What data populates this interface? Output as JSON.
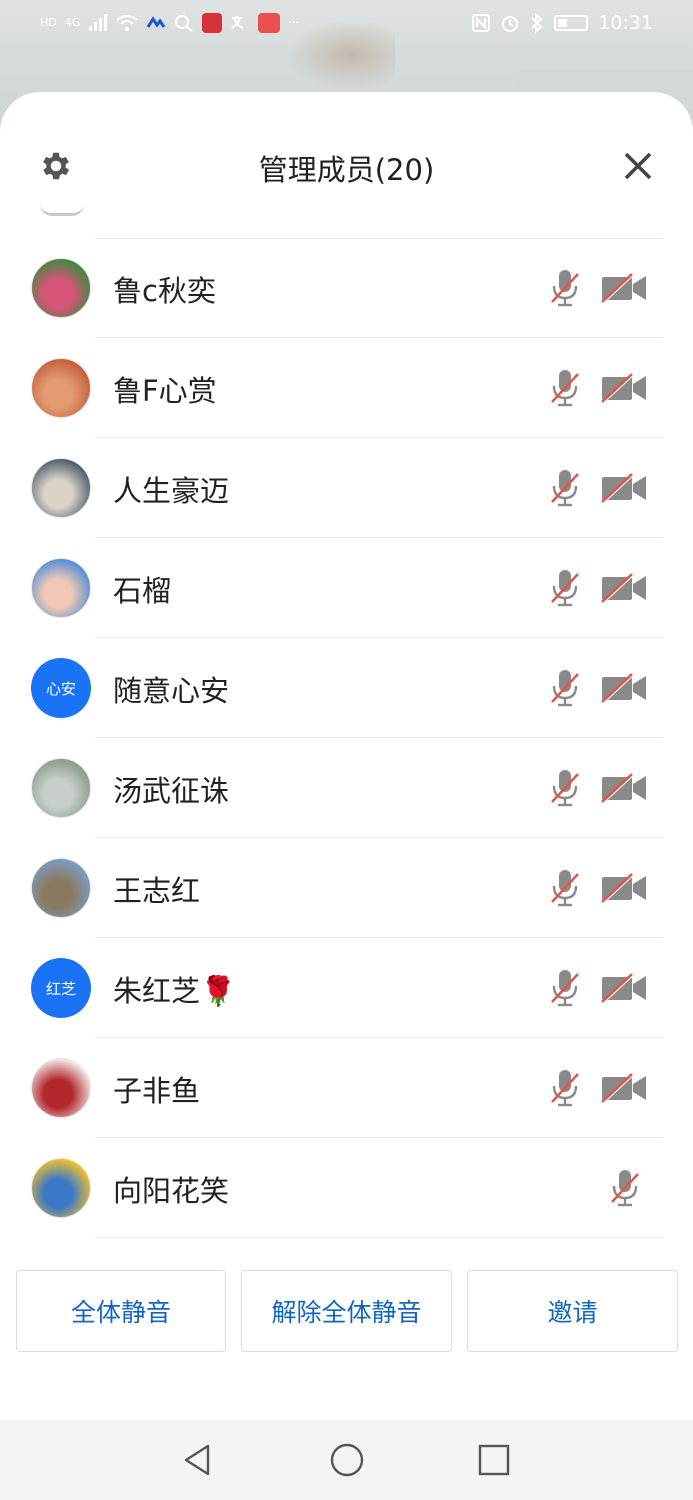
{
  "status_bar": {
    "time": "10:31",
    "left_labels": [
      "HD",
      "4G"
    ]
  },
  "header": {
    "title": "管理成员(20)"
  },
  "members": [
    {
      "name": "鲁c秋奕",
      "avatar_type": "photo",
      "avatar_colors": [
        "#3c8a3f",
        "#d8557a"
      ],
      "mic_muted": true,
      "camera_off": true
    },
    {
      "name": "鲁F心赏",
      "avatar_type": "photo",
      "avatar_colors": [
        "#c55d3a",
        "#e39b72"
      ],
      "mic_muted": true,
      "camera_off": true
    },
    {
      "name": "人生豪迈",
      "avatar_type": "photo",
      "avatar_colors": [
        "#4d5a6a",
        "#d9d3c8"
      ],
      "mic_muted": true,
      "camera_off": true
    },
    {
      "name": "石榴",
      "avatar_type": "photo",
      "avatar_colors": [
        "#4e8ed8",
        "#f0c8b5"
      ],
      "mic_muted": true,
      "camera_off": true
    },
    {
      "name": "随意心安",
      "avatar_type": "text",
      "avatar_text": "心安",
      "avatar_colors": [
        "#1a73f5"
      ],
      "mic_muted": true,
      "camera_off": true
    },
    {
      "name": "汤武征诛",
      "avatar_type": "photo",
      "avatar_colors": [
        "#8a9a8c",
        "#c8cfc8"
      ],
      "mic_muted": true,
      "camera_off": true
    },
    {
      "name": "王志红",
      "avatar_type": "photo",
      "avatar_colors": [
        "#7a9ec4",
        "#8a7a62"
      ],
      "mic_muted": true,
      "camera_off": true
    },
    {
      "name": "朱红芝🌹",
      "avatar_type": "text",
      "avatar_text": "红芝",
      "avatar_colors": [
        "#1a73f5"
      ],
      "mic_muted": true,
      "camera_off": true
    },
    {
      "name": "子非鱼",
      "avatar_type": "photo",
      "avatar_colors": [
        "#f2eeee",
        "#b3262b"
      ],
      "mic_muted": true,
      "camera_off": true
    },
    {
      "name": "向阳花笑",
      "avatar_type": "photo",
      "avatar_colors": [
        "#f3c32a",
        "#3c78c8"
      ],
      "mic_muted": true,
      "camera_off": null
    }
  ],
  "actions": {
    "mute_all": "全体静音",
    "unmute_all": "解除全体静音",
    "invite": "邀请"
  },
  "colors": {
    "accent_blue": "#1565c0",
    "avatar_blue": "#1a73f5",
    "muted_slash": "#e45445",
    "icon_gray": "#8a8a8a"
  }
}
